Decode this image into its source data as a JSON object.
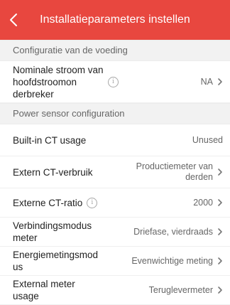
{
  "header": {
    "title": "Installatieparameters instellen"
  },
  "sections": [
    {
      "title": "Configuratie van de voeding",
      "rows": [
        {
          "label": "Nominale stroom van hoofdstroomon derbreker",
          "value": "NA",
          "info_icon": true,
          "chevron": true
        }
      ]
    },
    {
      "title": "Power sensor configuration",
      "rows": [
        {
          "label": "Built-in CT usage",
          "value": "Unused",
          "info_icon": false,
          "chevron": false
        },
        {
          "label": "Extern CT-verbruik",
          "value": "Productiemeter van derden",
          "info_icon": false,
          "chevron": true
        },
        {
          "label": "Externe CT-ratio",
          "value": "2000",
          "info_icon": true,
          "chevron": true
        },
        {
          "label": "Verbindingsmodus meter",
          "value": "Driefase, vierdraads",
          "info_icon": false,
          "chevron": true
        },
        {
          "label": "Energiemetingsmod us",
          "value": "Evenwichtige meting",
          "info_icon": false,
          "chevron": true
        },
        {
          "label": "External meter usage",
          "value": "Teruglevermeter",
          "info_icon": false,
          "chevron": true
        }
      ]
    }
  ],
  "colors": {
    "header_bg": "#e8473f",
    "page_bg": "#f4f4f4"
  }
}
